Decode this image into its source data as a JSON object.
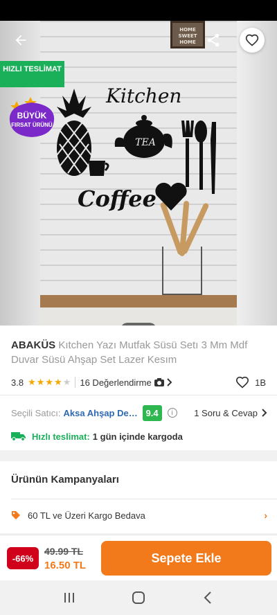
{
  "product": {
    "brand": "ABAKÜS",
    "title": "Kıtchen Yazı Mutfak Süsü Setı 3 Mm Mdf Duvar Süsü Ahşap Set Lazer Kesım",
    "rating": "3.8",
    "rating_value": 3.8,
    "reviews": "16 Değerlendirme",
    "likes": "1B"
  },
  "image": {
    "kitchen_word": "Kitchen",
    "tea_word": "TEA",
    "coffee_word": "Coffee",
    "frame_text": "HOME SWEET HOME",
    "pager_count": 2,
    "pager_active": 1
  },
  "badges": {
    "fast_delivery": "HIZLI TESLİMAT",
    "big_opportunity_1": "BÜYÜK",
    "big_opportunity_2": "FIRSAT ÜRÜNÜ"
  },
  "seller": {
    "label": "Seçili Satıcı:",
    "name": "Aksa Ahşap Dekor",
    "score": "9.4",
    "qa": "1 Soru & Cevap"
  },
  "shipping": {
    "label": "Hızlı teslimat:",
    "text": "1 gün içinde kargoda"
  },
  "campaign": {
    "title": "Ürünün Kampanyaları",
    "items": [
      {
        "label": "60 TL ve Üzeri Kargo Bedava"
      }
    ]
  },
  "cart": {
    "discount": "-66%",
    "old_price": "49.99 TL",
    "new_price": "16.50 TL",
    "button": "Sepete Ekle"
  },
  "colors": {
    "accent": "#f27a1a",
    "green": "#1aaf59",
    "seller_link": "#2d6ab4",
    "discount": "#d0021b",
    "star": "#f6a700"
  },
  "icons": [
    "back-arrow-icon",
    "share-icon",
    "heart-icon",
    "camera-icon",
    "chevron-right-icon",
    "info-icon",
    "truck-icon",
    "tag-icon",
    "recents-icon",
    "home-icon",
    "back-icon"
  ]
}
